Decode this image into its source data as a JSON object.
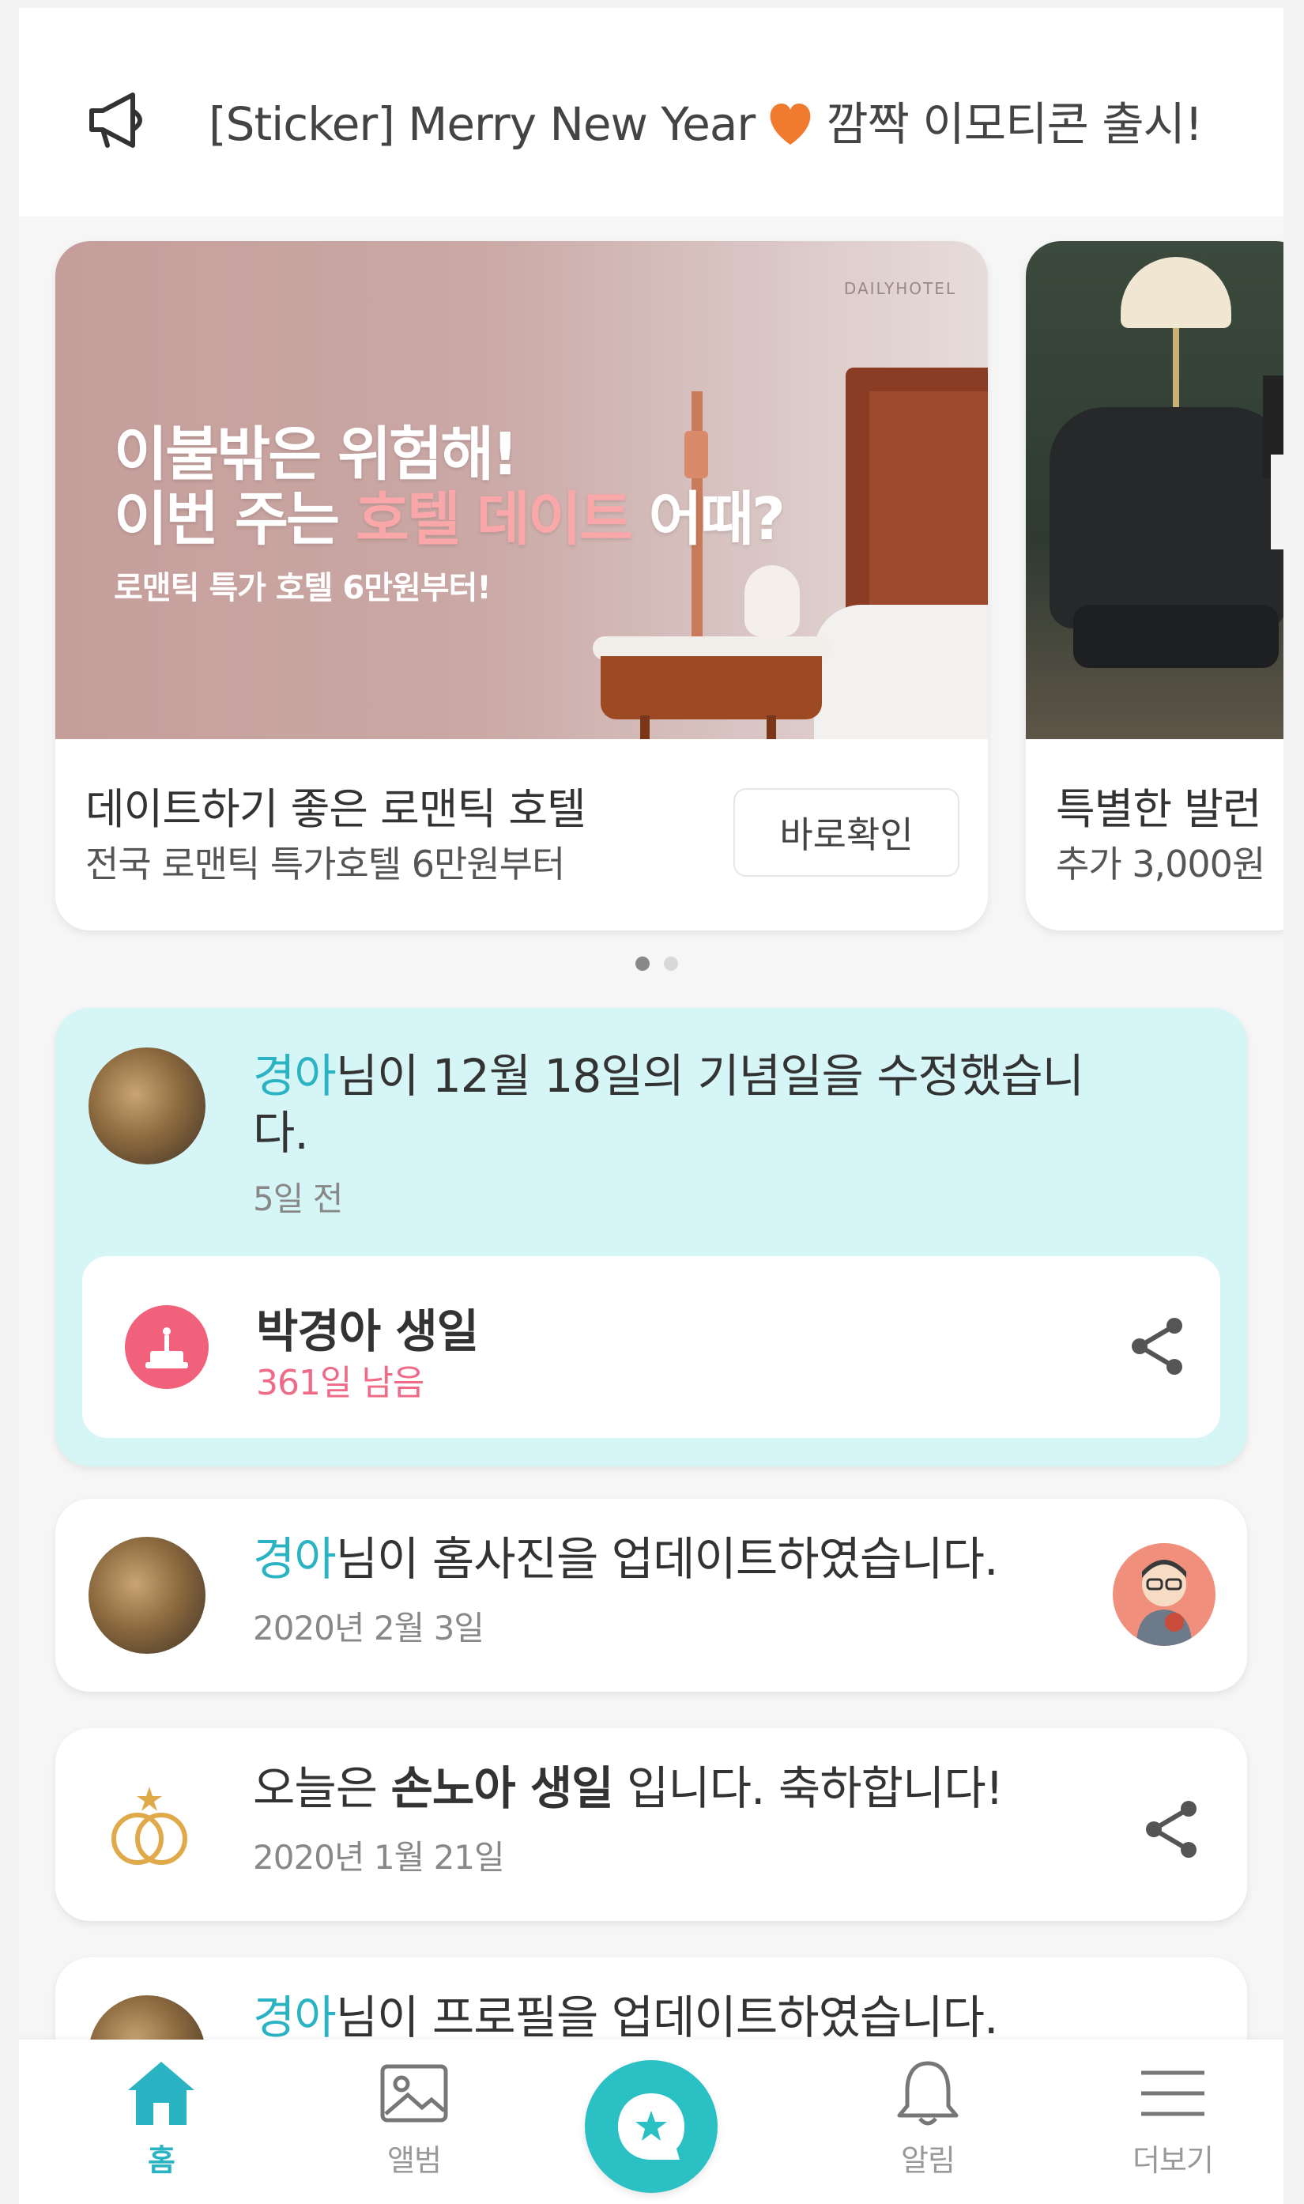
{
  "notice": {
    "text_before": "[Sticker] Merry New Year",
    "text_after": "깜짝 이모티콘 출시!"
  },
  "carousel": {
    "banners": [
      {
        "brand": "DAILYHOTEL",
        "headline_line1": "이불밖은 위험해!",
        "headline_line2_before": "이번 주는 ",
        "headline_line2_highlight": "호텔 데이트",
        "headline_line2_after": " 어때?",
        "headline_sub": "로맨틱 특가 호텔 6만원부터!",
        "title": "데이트하기 좋은 로맨틱 호텔",
        "subtitle": "전국 로맨틱 특가호텔 6만원부터",
        "button_label": "바로확인"
      },
      {
        "title": "특별한 발런",
        "subtitle": "추가 3,000원"
      }
    ],
    "page_count": 2,
    "active_index": 0
  },
  "feed": {
    "item1": {
      "name": "경아",
      "text_line1": "님이 12월 18일의 기념일을 수정했습니",
      "text_line2": "다.",
      "time": "5일 전",
      "event_title": "박경아 생일",
      "event_remaining": "361일 남음"
    },
    "item2": {
      "name": "경아",
      "text": "님이 홈사진을 업데이트하였습니다.",
      "time": "2020년 2월 3일"
    },
    "item3": {
      "text_before": "오늘은 ",
      "text_bold": "손노아 생일",
      "text_after": " 입니다. 축하합니다!",
      "time": "2020년 1월 21일"
    },
    "item4": {
      "name": "경아",
      "text": "님이 프로필을 업데이트하였습니다."
    }
  },
  "bottom_nav": {
    "home": "홈",
    "album": "앨범",
    "alarm": "알림",
    "more": "더보기"
  },
  "colors": {
    "accent": "#2ab3c2",
    "center_button": "#2bc0c4",
    "highlight_card": "#d6f5f6",
    "cake": "#f1617c",
    "remaining_text": "#ef6a86",
    "heart": "#f07a2e",
    "rings": "#e0a94a"
  },
  "icons": [
    "megaphone-icon",
    "heart-icon",
    "cake-icon",
    "share-icon",
    "rings-icon",
    "home-icon",
    "album-icon",
    "star-chat-icon",
    "bell-icon",
    "menu-icon"
  ]
}
